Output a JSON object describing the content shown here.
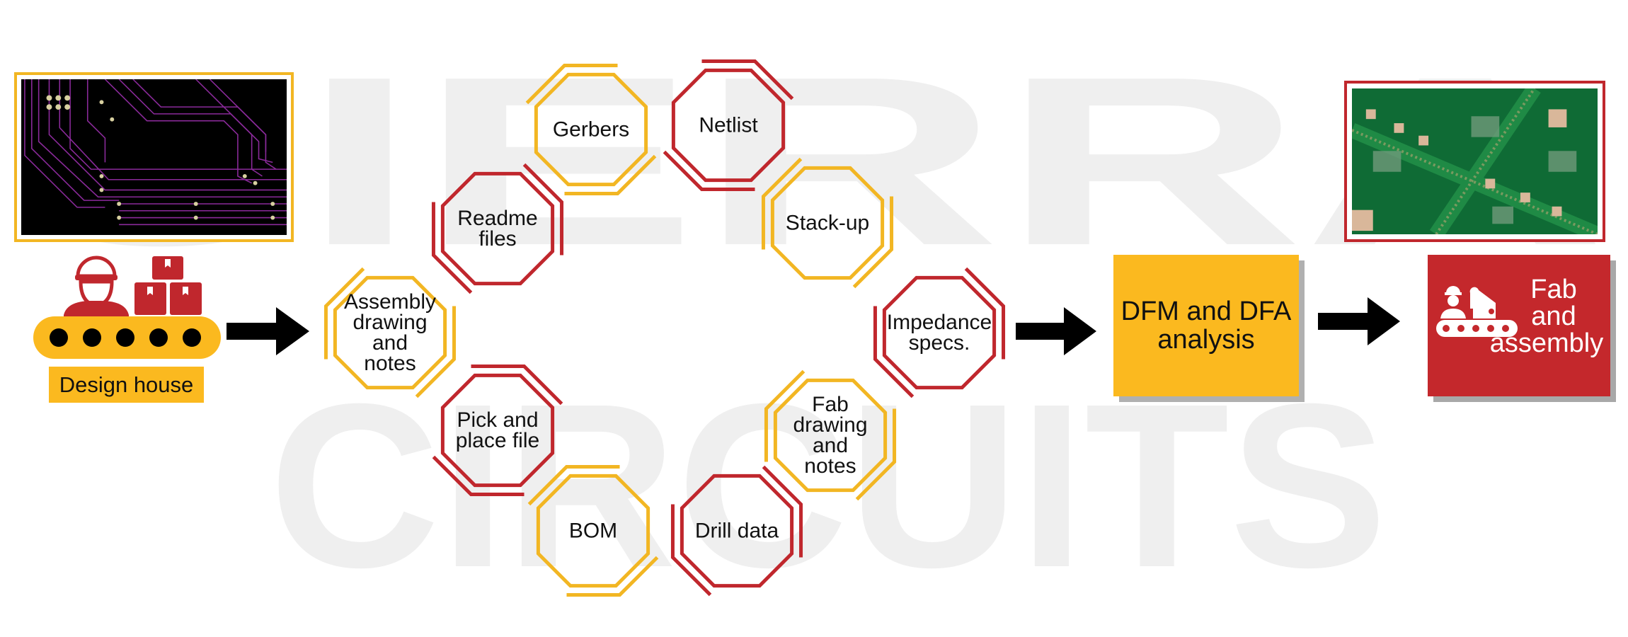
{
  "watermark": {
    "line1": "SIERRA",
    "line2": "CIRCUITS",
    "color": "#efefef"
  },
  "colors": {
    "yellow": "#f2b623",
    "red": "#c0272d",
    "black": "#000000",
    "box_yellow": "#fbb91f",
    "box_red": "#c4282c"
  },
  "source": {
    "label": "Design house",
    "image_left": "pcb-layout-image",
    "icons": [
      "worker-icon",
      "boxes-icon",
      "conveyor-icon"
    ]
  },
  "files": [
    {
      "id": "assembly",
      "lines": [
        "Assembly",
        "drawing",
        "and",
        "notes"
      ],
      "color": "yellow"
    },
    {
      "id": "readme",
      "lines": [
        "Readme",
        "files"
      ],
      "color": "red"
    },
    {
      "id": "gerbers",
      "lines": [
        "Gerbers"
      ],
      "color": "yellow"
    },
    {
      "id": "netlist",
      "lines": [
        "Netlist"
      ],
      "color": "red"
    },
    {
      "id": "stackup",
      "lines": [
        "Stack-up"
      ],
      "color": "yellow"
    },
    {
      "id": "impedance",
      "lines": [
        "Impedance",
        "specs."
      ],
      "color": "red"
    },
    {
      "id": "fab-drawing",
      "lines": [
        "Fab",
        "drawing",
        "and",
        "notes"
      ],
      "color": "yellow"
    },
    {
      "id": "drill",
      "lines": [
        "Drill data"
      ],
      "color": "red"
    },
    {
      "id": "bom",
      "lines": [
        "BOM"
      ],
      "color": "yellow"
    },
    {
      "id": "pick-place",
      "lines": [
        "Pick and",
        "place file"
      ],
      "color": "red"
    }
  ],
  "analysis": {
    "line1": "DFM and DFA",
    "line2": "analysis"
  },
  "output": {
    "line1": "Fab",
    "line2": "and",
    "line3": "assembly",
    "image_right": "pcb-board-photo"
  }
}
